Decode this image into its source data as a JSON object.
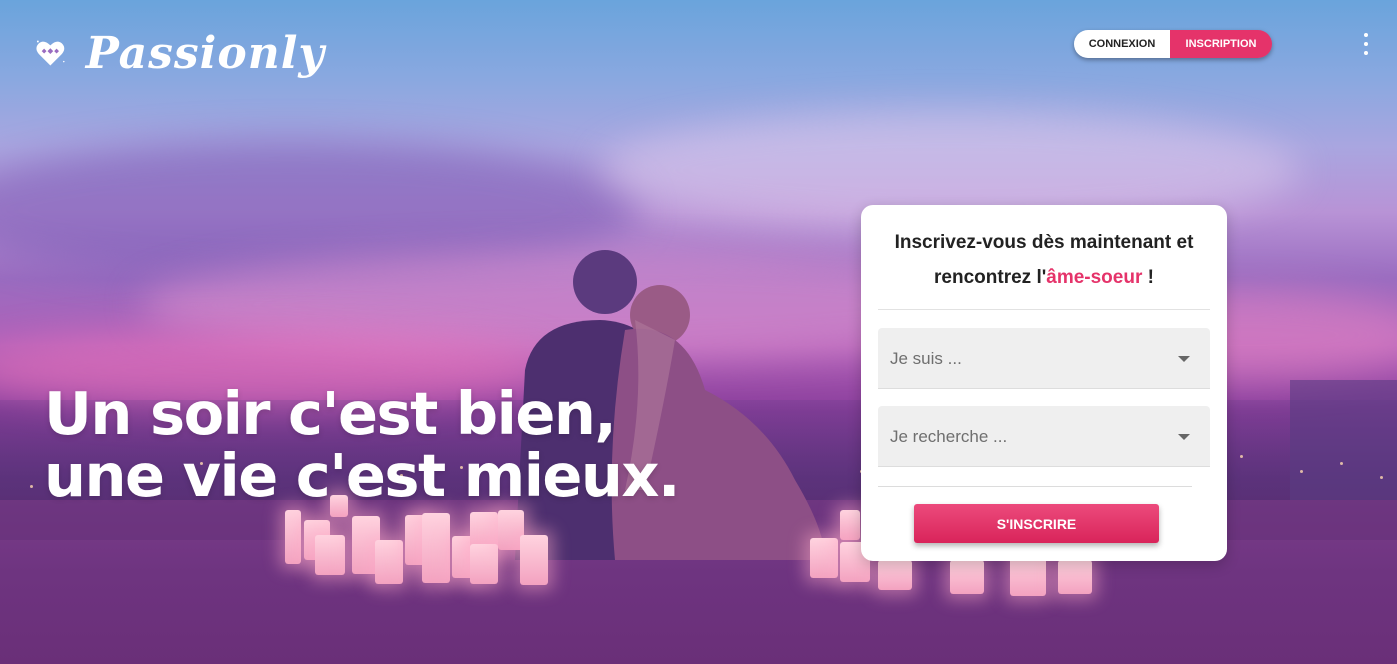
{
  "brand": {
    "name": "Passionly"
  },
  "nav": {
    "login_label": "CONNEXION",
    "signup_label": "INSCRIPTION"
  },
  "hero": {
    "line1": "Un soir c'est bien,",
    "line2": "une vie c'est mieux."
  },
  "signup_card": {
    "title_part1": "Inscrivez-vous dès maintenant et rencontrez l'",
    "title_accent": "âme-soeur",
    "title_part2": " !",
    "select_gender_placeholder": "Je suis ...",
    "select_seeking_placeholder": "Je recherche ...",
    "submit_label": "S'INSCRIRE"
  },
  "colors": {
    "accent": "#e5336a"
  },
  "icons": {
    "logo": "heart-logo-icon",
    "menu": "kebab-menu-icon",
    "dropdown": "chevron-down-icon"
  }
}
